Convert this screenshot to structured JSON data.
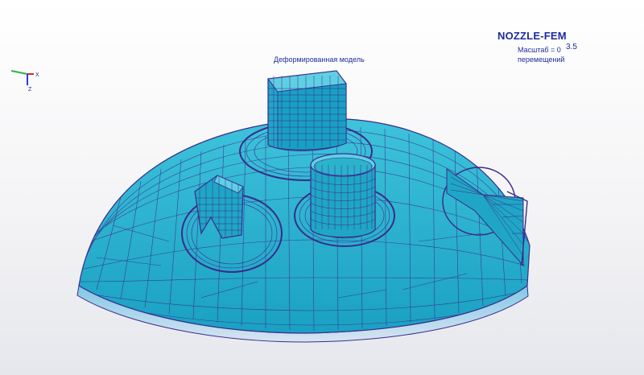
{
  "app": {
    "title": "NOZZLE-FEM"
  },
  "legend": {
    "scale_label": "Масштаб = 0",
    "scale_value": "3.5",
    "scale_sub": "перемещений"
  },
  "view": {
    "title": "Деформированная модель"
  },
  "axes": {
    "x_label": "X",
    "z_label": "Z"
  },
  "colors": {
    "mesh_fill": "#2bb3ce",
    "mesh_line": "#3a2b8c",
    "nozzle_fill": "#1fa6c6",
    "text": "#1f2c9a"
  }
}
